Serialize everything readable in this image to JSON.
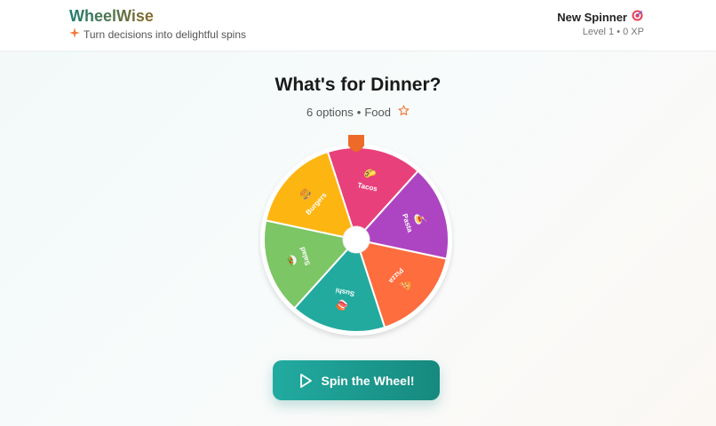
{
  "header": {
    "brand": "WheelWise",
    "tagline": "Turn decisions into delightful spins",
    "tagline_icon": "sparkle-icon",
    "user_name": "New Spinner",
    "user_icon": "target-icon",
    "level_text": "Level 1 • 0 XP"
  },
  "wheel": {
    "title": "What's for Dinner?",
    "option_count_text": "6 options",
    "separator": "•",
    "category": "Food",
    "favorite_icon": "star-outline-icon",
    "slices": [
      {
        "label": "Tacos",
        "emoji": "🌮",
        "color": "#e8407b"
      },
      {
        "label": "Pasta",
        "emoji": "🍝",
        "color": "#ad45c2"
      },
      {
        "label": "Pizza",
        "emoji": "🍕",
        "color": "#fd6d3e"
      },
      {
        "label": "Sushi",
        "emoji": "🍣",
        "color": "#22aa9f"
      },
      {
        "label": "Salad",
        "emoji": "🥗",
        "color": "#7cc665"
      },
      {
        "label": "Burgers",
        "emoji": "🍔",
        "color": "#fdb512"
      }
    ],
    "pointer_color": "#ee6a28"
  },
  "actions": {
    "spin_label": "Spin the Wheel!",
    "spin_icon": "play-icon"
  }
}
